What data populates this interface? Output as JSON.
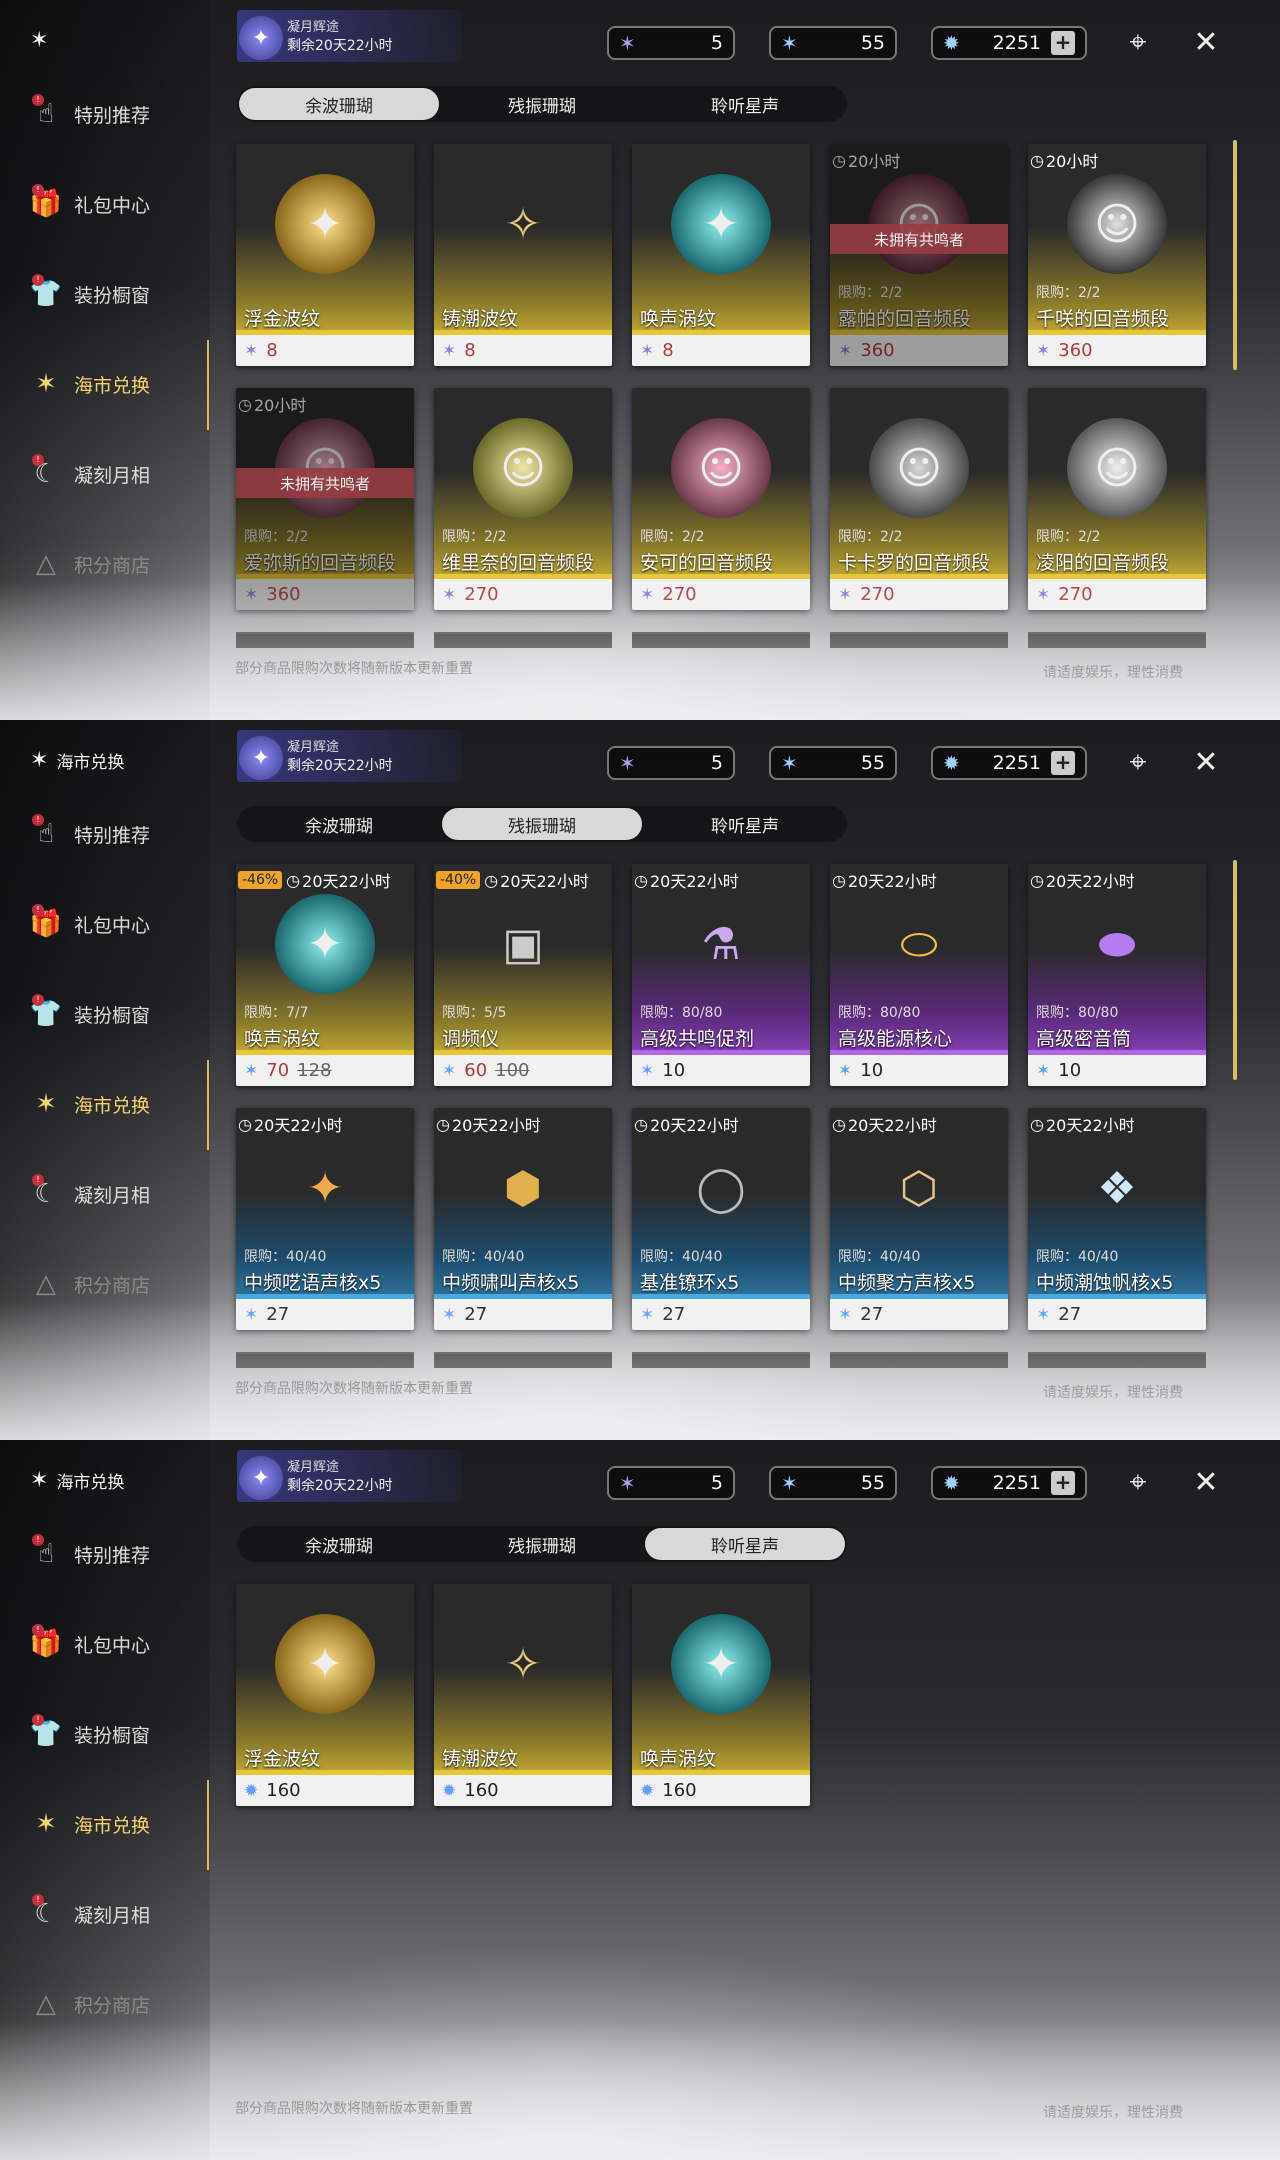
{
  "panels": [
    {
      "sidebar": {
        "header": "",
        "items": [
          {
            "label": "特别推荐"
          },
          {
            "label": "礼包中心"
          },
          {
            "label": "装扮橱窗"
          },
          {
            "label": "海市兑换"
          },
          {
            "label": "凝刻月相"
          },
          {
            "label": "积分商店"
          }
        ]
      },
      "event": {
        "title": "凝月辉途",
        "remaining": "剩余20天22小时"
      },
      "currency": [
        {
          "value": "5"
        },
        {
          "value": "55"
        },
        {
          "value": "2251"
        }
      ],
      "tabs": [
        {
          "label": "余波珊瑚"
        },
        {
          "label": "残振珊瑚"
        },
        {
          "label": "聆听星声"
        }
      ],
      "cards": [
        {
          "name": "浮金波纹",
          "price": "8"
        },
        {
          "name": "铸潮波纹",
          "price": "8"
        },
        {
          "name": "唤声涡纹",
          "price": "8"
        },
        {
          "name": "露帕的回音频段",
          "price": "360",
          "timer": "20小时",
          "limit": "限购：2/2",
          "owner": "未拥有共鸣者"
        },
        {
          "name": "千咲的回音频段",
          "price": "360",
          "timer": "20小时",
          "limit": "限购：2/2"
        },
        {
          "name": "爱弥斯的回音频段",
          "price": "360",
          "timer": "20小时",
          "limit": "限购：2/2",
          "owner": "未拥有共鸣者"
        },
        {
          "name": "维里奈的回音频段",
          "price": "270",
          "limit": "限购：2/2"
        },
        {
          "name": "安可的回音频段",
          "price": "270",
          "limit": "限购：2/2"
        },
        {
          "name": "卡卡罗的回音频段",
          "price": "270",
          "limit": "限购：2/2"
        },
        {
          "name": "凌阳的回音频段",
          "price": "270",
          "limit": "限购：2/2"
        }
      ],
      "footnote": "部分商品限购次数将随新版本更新重置",
      "footright": "请适度娱乐，理性消费"
    },
    {
      "sidebar": {
        "header": "海市兑换",
        "items": [
          {
            "label": "特别推荐"
          },
          {
            "label": "礼包中心"
          },
          {
            "label": "装扮橱窗"
          },
          {
            "label": "海市兑换"
          },
          {
            "label": "凝刻月相"
          },
          {
            "label": "积分商店"
          }
        ]
      },
      "event": {
        "title": "凝月辉途",
        "remaining": "剩余20天22小时"
      },
      "currency": [
        {
          "value": "5"
        },
        {
          "value": "55"
        },
        {
          "value": "2251"
        }
      ],
      "tabs": [
        {
          "label": "余波珊瑚"
        },
        {
          "label": "残振珊瑚"
        },
        {
          "label": "聆听星声"
        }
      ],
      "cards": [
        {
          "name": "唤声涡纹",
          "price": "70",
          "old": "128",
          "discount": "-46%",
          "timer": "20天22小时",
          "limit": "限购：7/7"
        },
        {
          "name": "调频仪",
          "price": "60",
          "old": "100",
          "discount": "-40%",
          "timer": "20天22小时",
          "limit": "限购：5/5"
        },
        {
          "name": "高级共鸣促剂",
          "price": "10",
          "timer": "20天22小时",
          "limit": "限购：80/80"
        },
        {
          "name": "高级能源核心",
          "price": "10",
          "timer": "20天22小时",
          "limit": "限购：80/80"
        },
        {
          "name": "高级密音筒",
          "price": "10",
          "timer": "20天22小时",
          "limit": "限购：80/80"
        },
        {
          "name": "中频呓语声核x5",
          "price": "27",
          "timer": "20天22小时",
          "limit": "限购：40/40"
        },
        {
          "name": "中频啸叫声核x5",
          "price": "27",
          "timer": "20天22小时",
          "limit": "限购：40/40"
        },
        {
          "name": "基准镣环x5",
          "price": "27",
          "timer": "20天22小时",
          "limit": "限购：40/40"
        },
        {
          "name": "中频聚方声核x5",
          "price": "27",
          "timer": "20天22小时",
          "limit": "限购：40/40"
        },
        {
          "name": "中频潮蚀帆核x5",
          "price": "27",
          "timer": "20天22小时",
          "limit": "限购：40/40"
        }
      ],
      "footnote": "部分商品限购次数将随新版本更新重置",
      "footright": "请适度娱乐，理性消费"
    },
    {
      "sidebar": {
        "header": "海市兑换",
        "items": [
          {
            "label": "特别推荐"
          },
          {
            "label": "礼包中心"
          },
          {
            "label": "装扮橱窗"
          },
          {
            "label": "海市兑换"
          },
          {
            "label": "凝刻月相"
          },
          {
            "label": "积分商店"
          }
        ]
      },
      "event": {
        "title": "凝月辉途",
        "remaining": "剩余20天22小时"
      },
      "currency": [
        {
          "value": "5"
        },
        {
          "value": "55"
        },
        {
          "value": "2251"
        }
      ],
      "tabs": [
        {
          "label": "余波珊瑚"
        },
        {
          "label": "残振珊瑚"
        },
        {
          "label": "聆听星声"
        }
      ],
      "cards": [
        {
          "name": "浮金波纹",
          "price": "160"
        },
        {
          "name": "铸潮波纹",
          "price": "160"
        },
        {
          "name": "唤声涡纹",
          "price": "160"
        }
      ],
      "footnote": "部分商品限购次数将随新版本更新重置",
      "footright": "请适度娱乐，理性消费"
    }
  ]
}
